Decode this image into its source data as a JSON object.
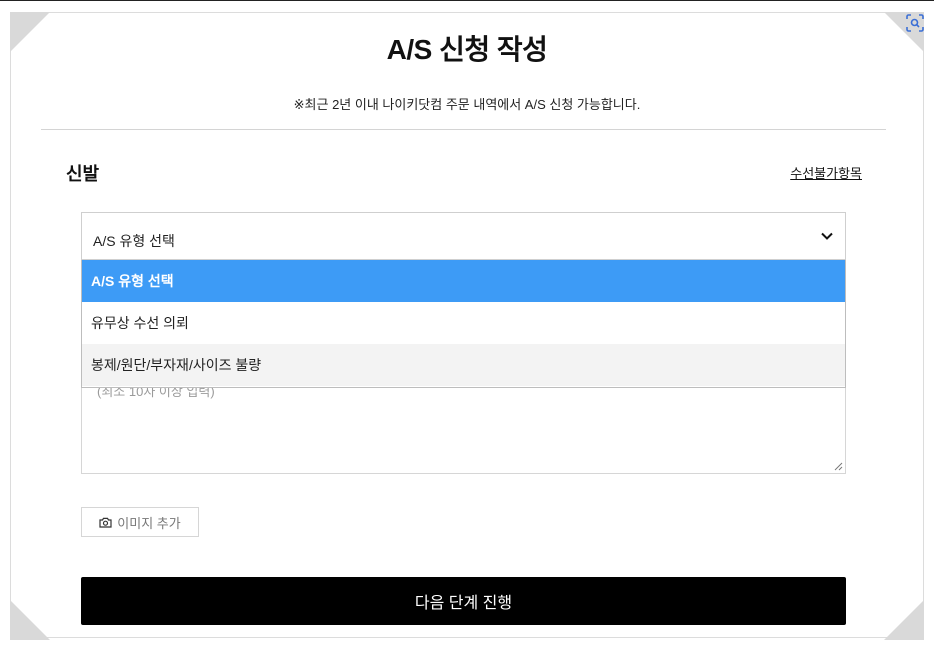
{
  "page": {
    "title": "A/S 신청 작성",
    "notice": "※최근 2년 이내 나이키닷컴 주문 내역에서 A/S 신청 가능합니다."
  },
  "section": {
    "title": "신발",
    "unavailable_link": "수선불가항목"
  },
  "as_type_select": {
    "selected_value": "A/S 유형 선택",
    "options": [
      {
        "label": "A/S 유형 선택",
        "state": "selected"
      },
      {
        "label": "유무상 수선 의뢰",
        "state": "normal"
      },
      {
        "label": "봉제/원단/부자재/사이즈 불량",
        "state": "hover"
      }
    ]
  },
  "description": {
    "placeholder_partial": "(최소 10자 이상 입력)"
  },
  "image_button": {
    "label": "이미지 추가",
    "icon": "camera-icon"
  },
  "next_button": {
    "label": "다음 단계 진행"
  },
  "browser": {
    "scan_icon": "screen-scan-icon"
  },
  "colors": {
    "selected_option": "#3d9bf6",
    "primary_button": "#000000",
    "corner": "#d9d9d9"
  }
}
